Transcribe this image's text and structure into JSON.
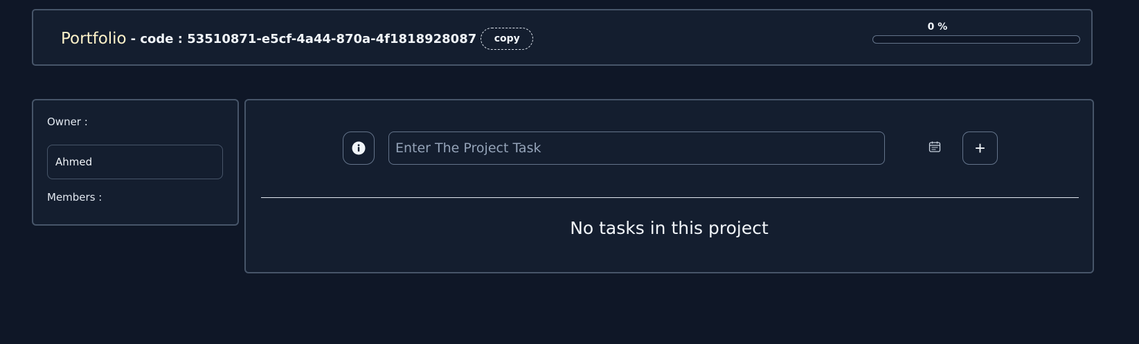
{
  "header": {
    "title": "Portfolio",
    "code_text": "- code : 53510871-e5cf-4a44-870a-4f1818928087",
    "copy_label": "copy",
    "progress_label": "0 %",
    "progress_percent": 0
  },
  "sidebar": {
    "owner_label": "Owner :",
    "owner_name": "Ahmed",
    "members_label": "Members :"
  },
  "main": {
    "info_icon": "info-icon",
    "task_input_placeholder": "Enter The Project Task",
    "task_input_value": "",
    "calendar_icon": "calendar-icon",
    "add_label": "+",
    "empty_message": "No tasks in this project"
  },
  "colors": {
    "background": "#0f1727",
    "panel": "#141e2f",
    "border": "#475569",
    "title": "#fdf2c9",
    "text": "#f1f5f9"
  }
}
